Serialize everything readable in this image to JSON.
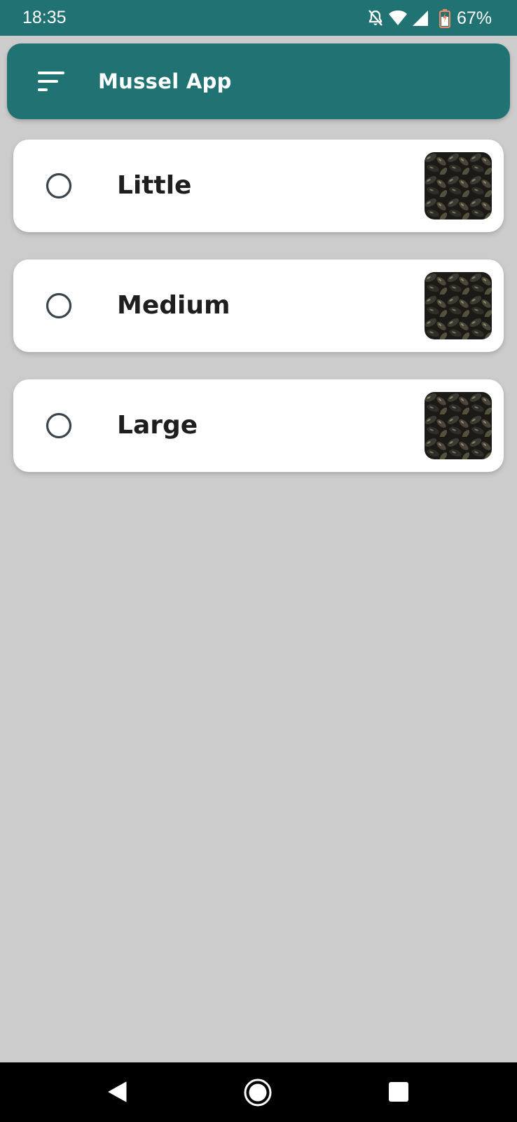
{
  "status_bar": {
    "time": "18:35",
    "battery_percent": "67%",
    "icons": [
      "notifications-off-icon",
      "wifi-icon",
      "cellular-signal-icon",
      "battery-charging-icon"
    ]
  },
  "app_bar": {
    "title": "Mussel App",
    "menu_icon": "sort-menu-icon"
  },
  "options": [
    {
      "label": "Little",
      "selected": false,
      "thumbnail": "mussels-photo"
    },
    {
      "label": "Medium",
      "selected": false,
      "thumbnail": "mussels-photo"
    },
    {
      "label": "Large",
      "selected": false,
      "thumbnail": "mussels-photo"
    }
  ],
  "nav_bar": {
    "icons": [
      "back-icon",
      "home-icon",
      "recents-icon"
    ]
  },
  "colors": {
    "primary": "#217272",
    "background": "#cccccc",
    "card": "#ffffff",
    "text": "#1e1e1e",
    "radio_outline": "#3a444c"
  }
}
